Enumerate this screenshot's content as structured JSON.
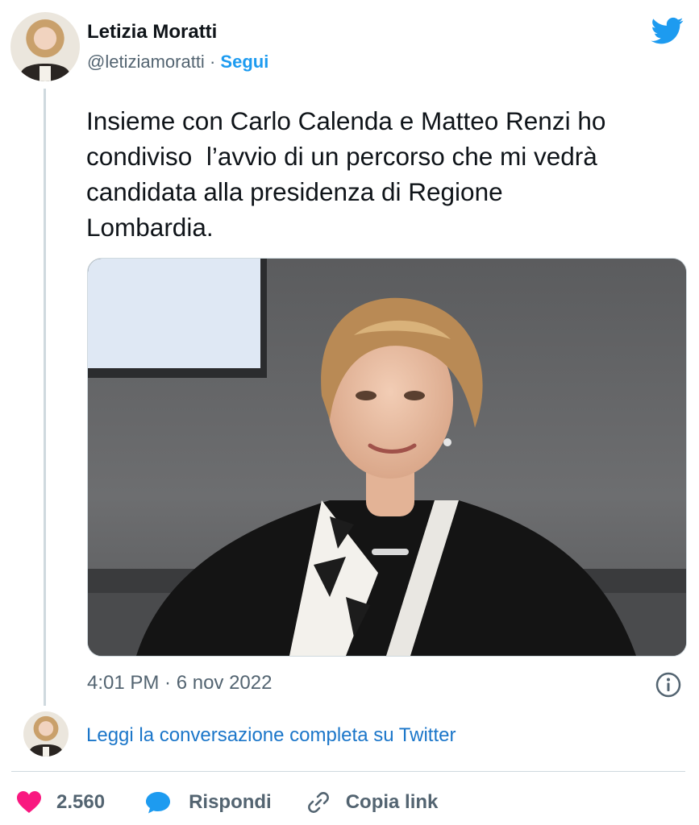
{
  "author": {
    "name": "Letizia Moratti",
    "handle": "@letiziamoratti",
    "separator": "·",
    "follow_label": "Segui"
  },
  "icons": {
    "logo": "twitter-bird-icon",
    "info": "info-icon",
    "like": "heart-icon",
    "reply": "speech-bubble-icon",
    "copy": "link-icon"
  },
  "colors": {
    "accent": "#1d9bf0",
    "like": "#f91880",
    "muted": "#536471",
    "text": "#0f1419"
  },
  "tweet": {
    "text": "Insieme con Carlo Calenda e Matteo Renzi ho\ncondiviso  l’avvio di un percorso che mi vedrà\ncandidata alla presidenza di Regione\nLombardia.",
    "timestamp": "4:01 PM · 6 nov 2022"
  },
  "conversation_link": "Leggi la conversazione completa su Twitter",
  "actions": {
    "likes": "2.560",
    "reply_label": "Rispondi",
    "copy_label": "Copia link"
  }
}
